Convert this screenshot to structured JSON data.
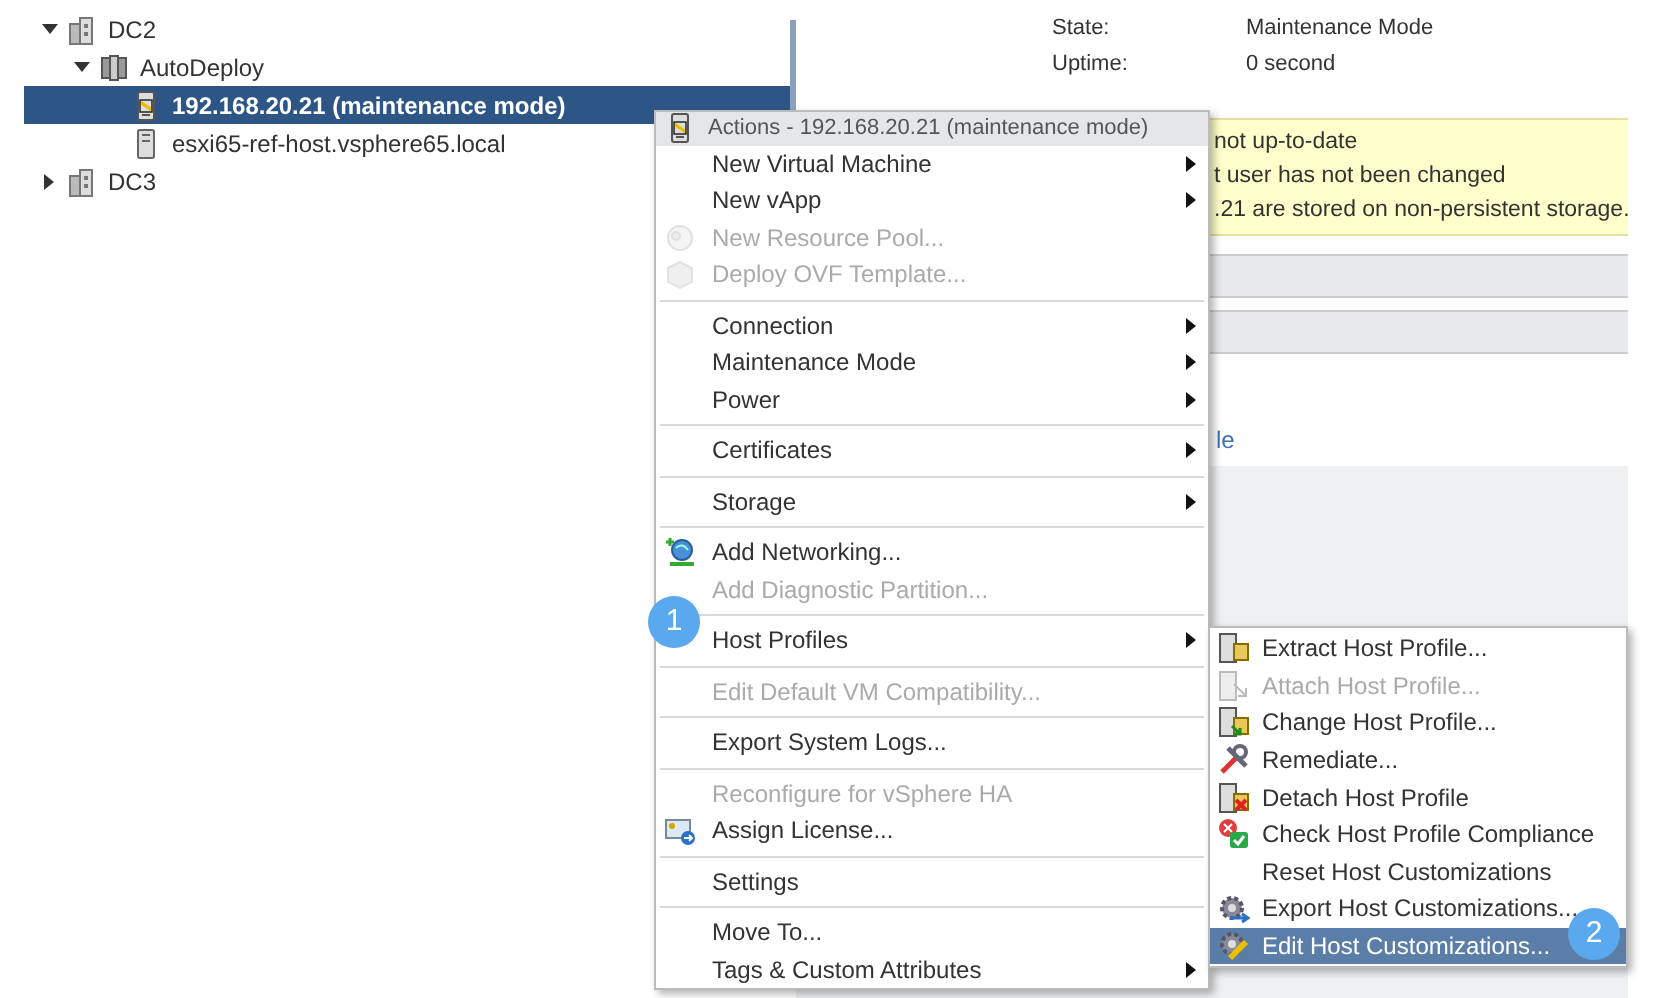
{
  "tree": [
    {
      "label": "DC2",
      "kind": "datacenter",
      "expanded": true,
      "selected": false,
      "children": [
        {
          "label": "AutoDeploy",
          "kind": "cluster",
          "expanded": true,
          "selected": false,
          "children": [
            {
              "label": "192.168.20.21 (maintenance mode)",
              "kind": "maintenance",
              "selected": true
            },
            {
              "label": "esxi65-ref-host.vsphere65.local",
              "kind": "host",
              "selected": false
            }
          ]
        }
      ]
    },
    {
      "label": "DC3",
      "kind": "datacenter",
      "expanded": false,
      "selected": false
    }
  ],
  "summary": {
    "properties": [
      {
        "label": "State:",
        "value": "Maintenance Mode"
      },
      {
        "label": "Uptime:",
        "value": "0 second"
      }
    ],
    "warnings": [
      "not up-to-date",
      "t user has not been changed",
      ".21 are stored on non-persistent storage."
    ],
    "link": "le"
  },
  "context_menu": {
    "title": "Actions - 192.168.20.21 (maintenance mode)",
    "groups": [
      [
        {
          "label": "New Virtual Machine",
          "disabled": false,
          "submenu": true
        },
        {
          "label": "New vApp",
          "disabled": false,
          "submenu": true
        },
        {
          "label": "New Resource Pool...",
          "disabled": true,
          "submenu": false
        },
        {
          "label": "Deploy OVF Template...",
          "disabled": true,
          "submenu": false
        }
      ],
      [
        {
          "label": "Connection",
          "disabled": false,
          "submenu": true
        },
        {
          "label": "Maintenance Mode",
          "disabled": false,
          "submenu": true
        },
        {
          "label": "Power",
          "disabled": false,
          "submenu": true
        }
      ],
      [
        {
          "label": "Certificates",
          "disabled": false,
          "submenu": true
        }
      ],
      [
        {
          "label": "Storage",
          "disabled": false,
          "submenu": true
        }
      ],
      [
        {
          "label": "Add Networking...",
          "disabled": false,
          "submenu": false
        },
        {
          "label": "Add Diagnostic Partition...",
          "disabled": true,
          "submenu": false
        }
      ],
      [
        {
          "label": "Host Profiles",
          "disabled": false,
          "submenu": true
        }
      ],
      [
        {
          "label": "Edit Default VM Compatibility...",
          "disabled": true,
          "submenu": false
        }
      ],
      [
        {
          "label": "Export System Logs...",
          "disabled": false,
          "submenu": false
        }
      ],
      [
        {
          "label": "Reconfigure for vSphere HA",
          "disabled": true,
          "submenu": false
        },
        {
          "label": "Assign License...",
          "disabled": false,
          "submenu": false
        }
      ],
      [
        {
          "label": "Settings",
          "disabled": false,
          "submenu": false
        }
      ],
      [
        {
          "label": "Move To...",
          "disabled": false,
          "submenu": false
        },
        {
          "label": "Tags & Custom Attributes",
          "disabled": false,
          "submenu": true
        }
      ]
    ]
  },
  "submenu": {
    "items": [
      {
        "label": "Extract Host Profile...",
        "disabled": false,
        "selected": false
      },
      {
        "label": "Attach Host Profile...",
        "disabled": true,
        "selected": false
      },
      {
        "label": "Change Host Profile...",
        "disabled": false,
        "selected": false
      },
      {
        "label": "Remediate...",
        "disabled": false,
        "selected": false
      },
      {
        "label": "Detach Host Profile",
        "disabled": false,
        "selected": false
      },
      {
        "label": "Check Host Profile Compliance",
        "disabled": false,
        "selected": false
      },
      {
        "label": "Reset Host Customizations",
        "disabled": false,
        "selected": false
      },
      {
        "label": "Export Host Customizations...",
        "disabled": false,
        "selected": false
      },
      {
        "label": "Edit Host Customizations...",
        "disabled": false,
        "selected": true
      }
    ]
  },
  "callouts": [
    "1",
    "2"
  ]
}
